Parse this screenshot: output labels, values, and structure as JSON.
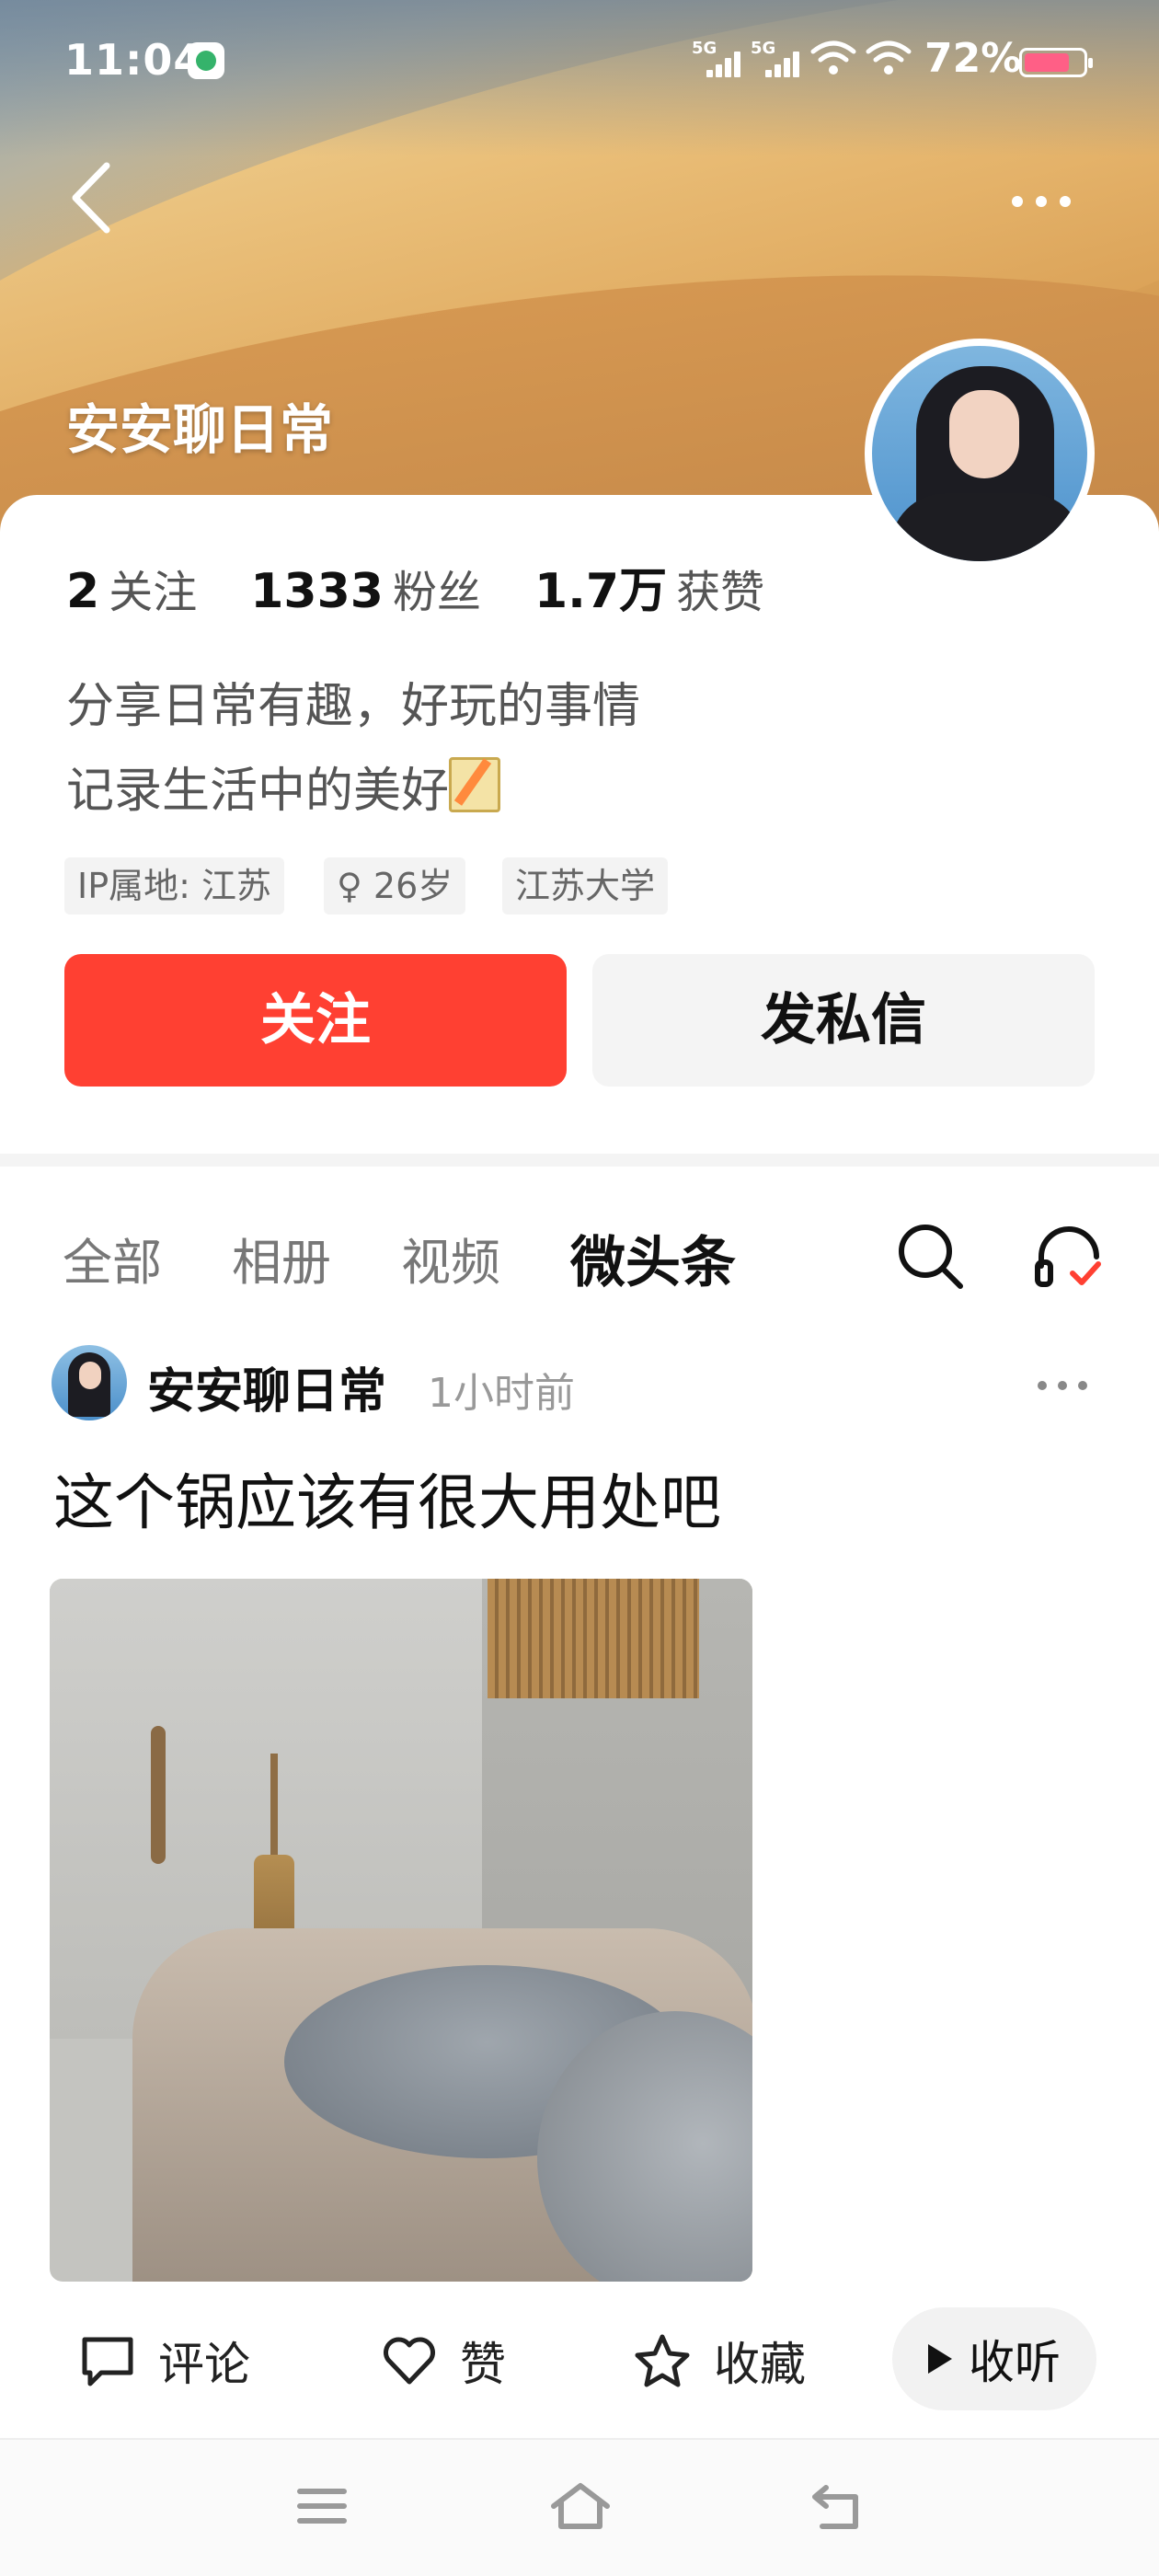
{
  "status_bar": {
    "time": "11:04",
    "signal1": "5G",
    "signal2": "5G",
    "battery_percent": "72%"
  },
  "header": {
    "profile_name": "安安聊日常"
  },
  "profile": {
    "stats": [
      {
        "number": "2",
        "label": "关注"
      },
      {
        "number": "1333",
        "label": "粉丝"
      },
      {
        "number": "1.7万",
        "label": "获赞"
      }
    ],
    "bio_line1": "分享日常有趣，好玩的事情",
    "bio_line2": "记录生活中的美好",
    "tags": [
      "IP属地: 江苏",
      "♀ 26岁",
      "江苏大学"
    ],
    "follow_label": "关注",
    "message_label": "发私信"
  },
  "tabs": [
    "全部",
    "相册",
    "视频",
    "微头条"
  ],
  "active_tab": "微头条",
  "post": {
    "author": "安安聊日常",
    "time": "1小时前",
    "text": "这个锅应该有很大用处吧",
    "actions": {
      "comment": "评论",
      "like": "赞",
      "favorite": "收藏",
      "listen": "收听"
    }
  },
  "colors": {
    "accent_red": "#ff4032",
    "battery_pink": "#ff5f86"
  }
}
